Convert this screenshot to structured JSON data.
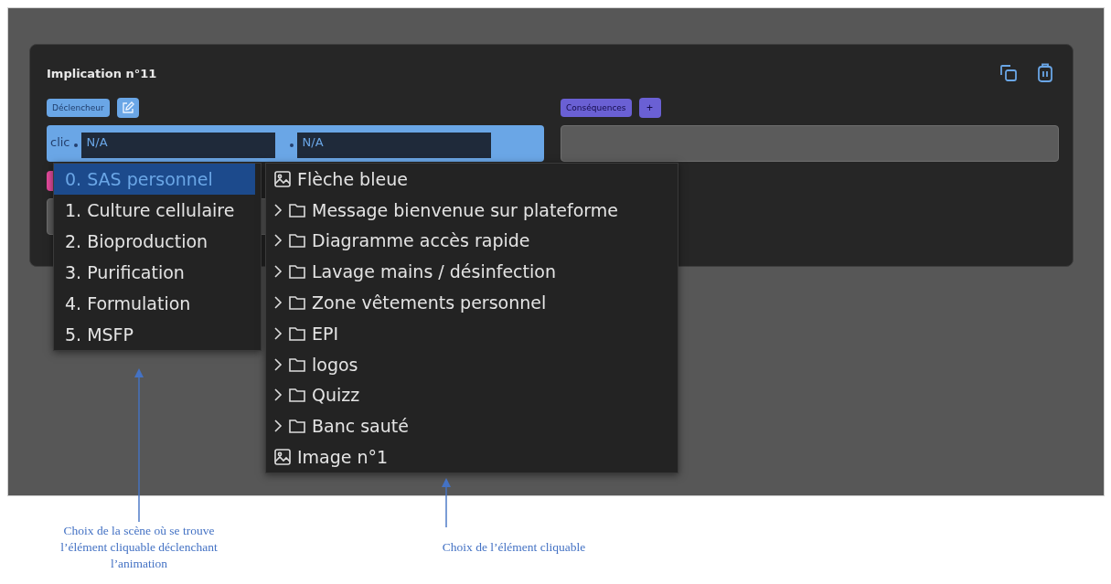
{
  "card": {
    "title": "Implication n°11",
    "trigger": {
      "label": "Déclencheur",
      "event": "clic",
      "scene_value": "N/A",
      "element_value": "N/A"
    },
    "consequences": {
      "label": "Conséquences",
      "add_label": "+"
    }
  },
  "scene_menu": [
    {
      "label": "0. SAS personnel",
      "selected": true
    },
    {
      "label": "1. Culture cellulaire",
      "selected": false
    },
    {
      "label": "2. Bioproduction",
      "selected": false
    },
    {
      "label": "3. Purification",
      "selected": false
    },
    {
      "label": "4. Formulation",
      "selected": false
    },
    {
      "label": "5. MSFP",
      "selected": false
    }
  ],
  "element_menu": [
    {
      "kind": "image",
      "label": "Flèche bleue"
    },
    {
      "kind": "folder",
      "label": "Message bienvenue sur plateforme"
    },
    {
      "kind": "folder",
      "label": "Diagramme accès rapide"
    },
    {
      "kind": "folder",
      "label": "Lavage mains / désinfection"
    },
    {
      "kind": "folder",
      "label": "Zone vêtements personnel"
    },
    {
      "kind": "folder",
      "label": "EPI"
    },
    {
      "kind": "folder",
      "label": "logos"
    },
    {
      "kind": "folder",
      "label": "Quizz"
    },
    {
      "kind": "folder",
      "label": "Banc sauté"
    },
    {
      "kind": "image",
      "label": "Image n°1"
    }
  ],
  "annotations": [
    {
      "text": "Choix de la scène où se trouve l’élément cliquable déclenchant l’animation"
    },
    {
      "text": "Choix de l’élément cliquable"
    }
  ]
}
